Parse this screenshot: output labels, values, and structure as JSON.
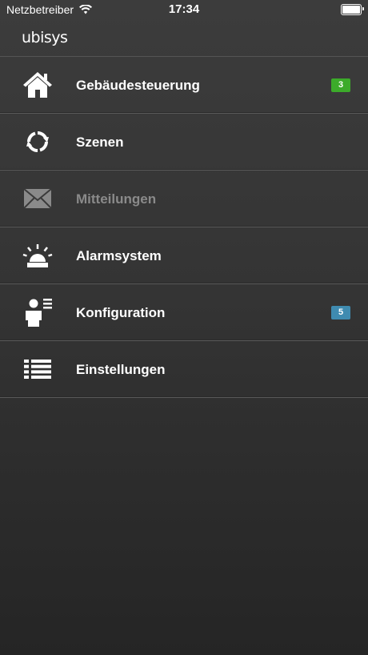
{
  "status_bar": {
    "carrier": "Netzbetreiber",
    "time": "17:34",
    "wifi_icon": "wifi-icon",
    "battery_icon": "battery-icon"
  },
  "header": {
    "logo": "ubisys"
  },
  "menu": {
    "items": [
      {
        "label": "Gebäudesteuerung",
        "icon": "house-icon",
        "badge": "3",
        "badge_color": "#3cab2a",
        "disabled": false
      },
      {
        "label": "Szenen",
        "icon": "refresh-icon",
        "badge": "",
        "disabled": false
      },
      {
        "label": "Mitteilungen",
        "icon": "envelope-icon",
        "badge": "",
        "disabled": true
      },
      {
        "label": "Alarmsystem",
        "icon": "alarm-light-icon",
        "badge": "",
        "disabled": false
      },
      {
        "label": "Konfiguration",
        "icon": "user-config-icon",
        "badge": "5",
        "badge_color": "#3f8bb0",
        "disabled": false
      },
      {
        "label": "Einstellungen",
        "icon": "list-icon",
        "badge": "",
        "disabled": false
      }
    ]
  },
  "colors": {
    "background_top": "#3c3c3c",
    "background_bottom": "#252525",
    "text": "#ffffff",
    "disabled_text": "#8a8a8a",
    "badge_green": "#3cab2a",
    "badge_blue": "#3f8bb0"
  }
}
